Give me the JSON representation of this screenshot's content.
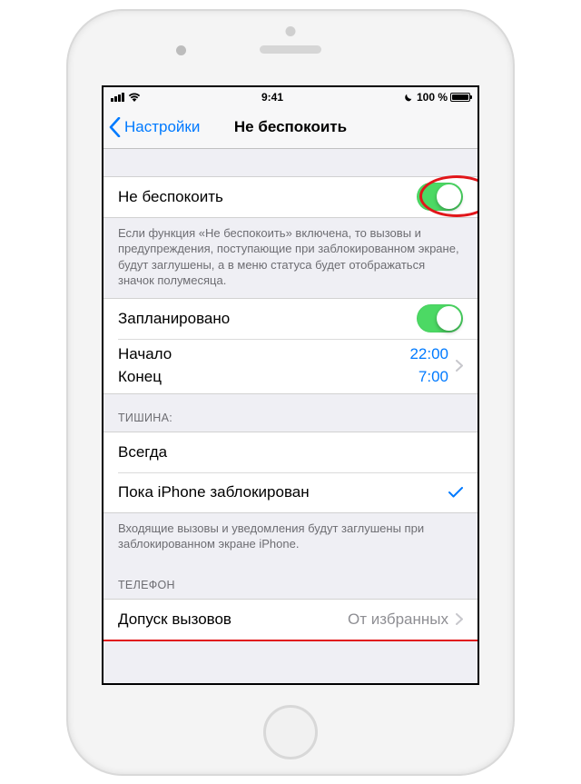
{
  "statusbar": {
    "time": "9:41",
    "battery_percent": "100 %"
  },
  "nav": {
    "back_label": "Настройки",
    "title": "Не беспокоить"
  },
  "dnd": {
    "label": "Не беспокоить",
    "footer": "Если функция «Не беспокоить» включена, то вызовы и предупреждения, поступающие при заблокированном экране, будут заглушены, а в меню статуса будет отображаться значок полумесяца."
  },
  "scheduled": {
    "label": "Запланировано",
    "from_label": "Начало",
    "from_value": "22:00",
    "to_label": "Конец",
    "to_value": "7:00"
  },
  "silence": {
    "header": "ТИШИНА:",
    "always": "Всегда",
    "while_locked": "Пока iPhone заблокирован",
    "footer": "Входящие вызовы и уведомления будут заглушены при заблокированном экране iPhone."
  },
  "phone": {
    "header": "ТЕЛЕФОН",
    "allow_calls_label": "Допуск вызовов",
    "allow_calls_value": "От избранных"
  }
}
